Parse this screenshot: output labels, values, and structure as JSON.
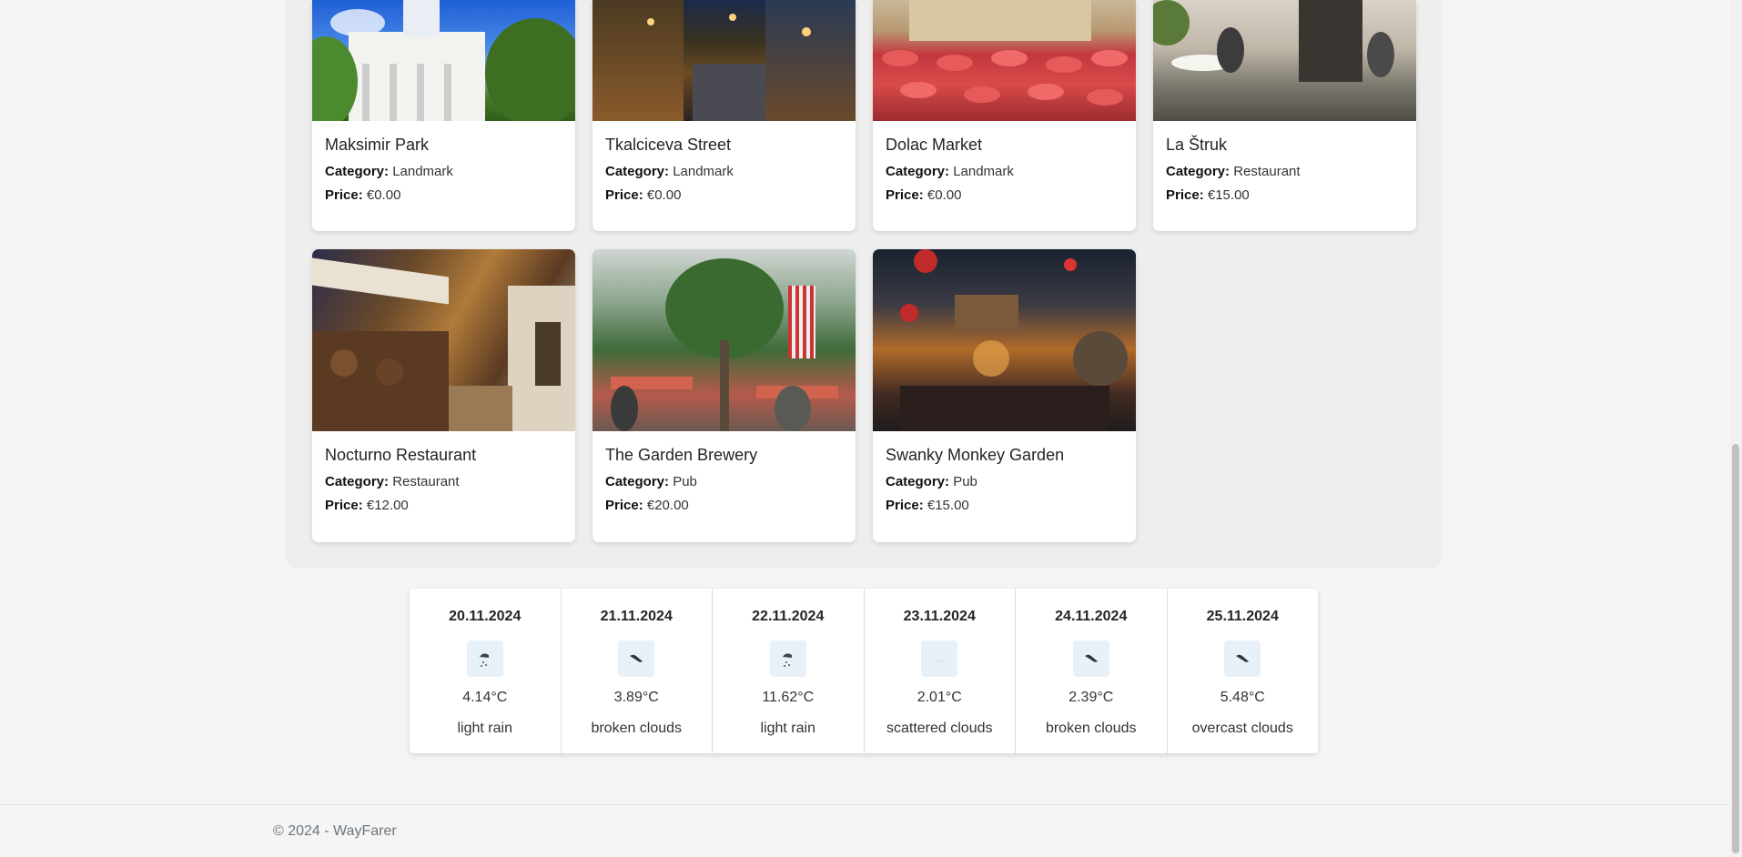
{
  "places": [
    {
      "name": "Maksimir Park",
      "category_label": "Category:",
      "category": "Landmark",
      "price_label": "Price:",
      "price": "€0.00",
      "image": "park-pavilion-image"
    },
    {
      "name": "Tkalciceva Street",
      "category_label": "Category:",
      "category": "Landmark",
      "price_label": "Price:",
      "price": "€0.00",
      "image": "night-street-image"
    },
    {
      "name": "Dolac Market",
      "category_label": "Category:",
      "category": "Landmark",
      "price_label": "Price:",
      "price": "€0.00",
      "image": "market-umbrellas-image"
    },
    {
      "name": "La Štruk",
      "category_label": "Category:",
      "category": "Restaurant",
      "price_label": "Price:",
      "price": "€15.00",
      "image": "courtyard-restaurant-image"
    },
    {
      "name": "Nocturno Restaurant",
      "category_label": "Category:",
      "category": "Restaurant",
      "price_label": "Price:",
      "price": "€12.00",
      "image": "alley-restaurant-image"
    },
    {
      "name": "The Garden Brewery",
      "category_label": "Category:",
      "category": "Pub",
      "price_label": "Price:",
      "price": "€20.00",
      "image": "brewery-interior-image"
    },
    {
      "name": "Swanky Monkey Garden",
      "category_label": "Category:",
      "category": "Pub",
      "price_label": "Price:",
      "price": "€15.00",
      "image": "garden-bar-image"
    }
  ],
  "weather": [
    {
      "date": "20.11.2024",
      "temp": "4.14°C",
      "desc": "light rain",
      "icon": "rain-icon"
    },
    {
      "date": "21.11.2024",
      "temp": "3.89°C",
      "desc": "broken clouds",
      "icon": "broken-clouds-icon"
    },
    {
      "date": "22.11.2024",
      "temp": "11.62°C",
      "desc": "light rain",
      "icon": "rain-icon"
    },
    {
      "date": "23.11.2024",
      "temp": "2.01°C",
      "desc": "scattered clouds",
      "icon": "scattered-clouds-icon"
    },
    {
      "date": "24.11.2024",
      "temp": "2.39°C",
      "desc": "broken clouds",
      "icon": "broken-clouds-icon"
    },
    {
      "date": "25.11.2024",
      "temp": "5.48°C",
      "desc": "overcast clouds",
      "icon": "broken-clouds-icon"
    }
  ],
  "footer": {
    "copyright": "© 2024 - WayFarer"
  },
  "colors": {
    "page_bg": "#f5f5f5",
    "panel_bg": "#eeeeee",
    "card_bg": "#ffffff",
    "footer_text": "#6c757d"
  }
}
